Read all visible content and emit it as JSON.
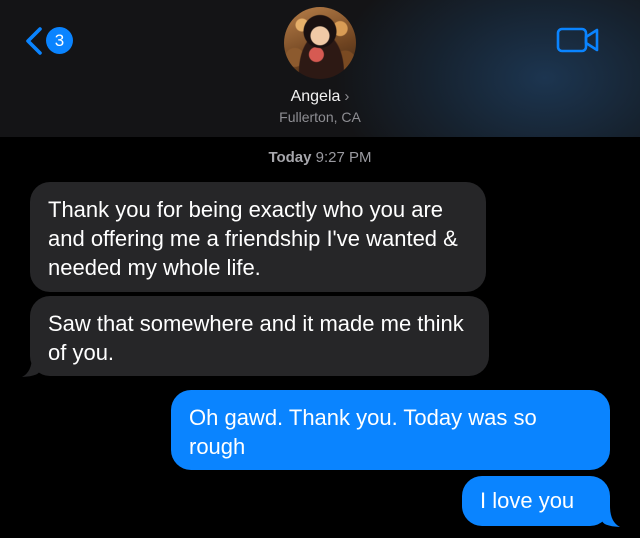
{
  "header": {
    "unread_count": "3",
    "contact_name": "Angela",
    "contact_location": "Fullerton, CA"
  },
  "thread": {
    "timestamp_day": "Today",
    "timestamp_time": "9:27 PM",
    "messages": [
      {
        "direction": "incoming",
        "text": "Thank you for being exactly who you are and offering me a friendship I've wanted & needed my whole life."
      },
      {
        "direction": "incoming",
        "text": "Saw that somewhere and it made me think of you."
      },
      {
        "direction": "outgoing",
        "text": "Oh gawd. Thank you. Today was so rough"
      },
      {
        "direction": "outgoing",
        "text": "I love you"
      }
    ]
  },
  "colors": {
    "accent": "#0a84ff",
    "incoming_bubble": "#262628",
    "background": "#000000"
  },
  "icons": [
    "back-chevron-icon",
    "video-camera-icon"
  ]
}
